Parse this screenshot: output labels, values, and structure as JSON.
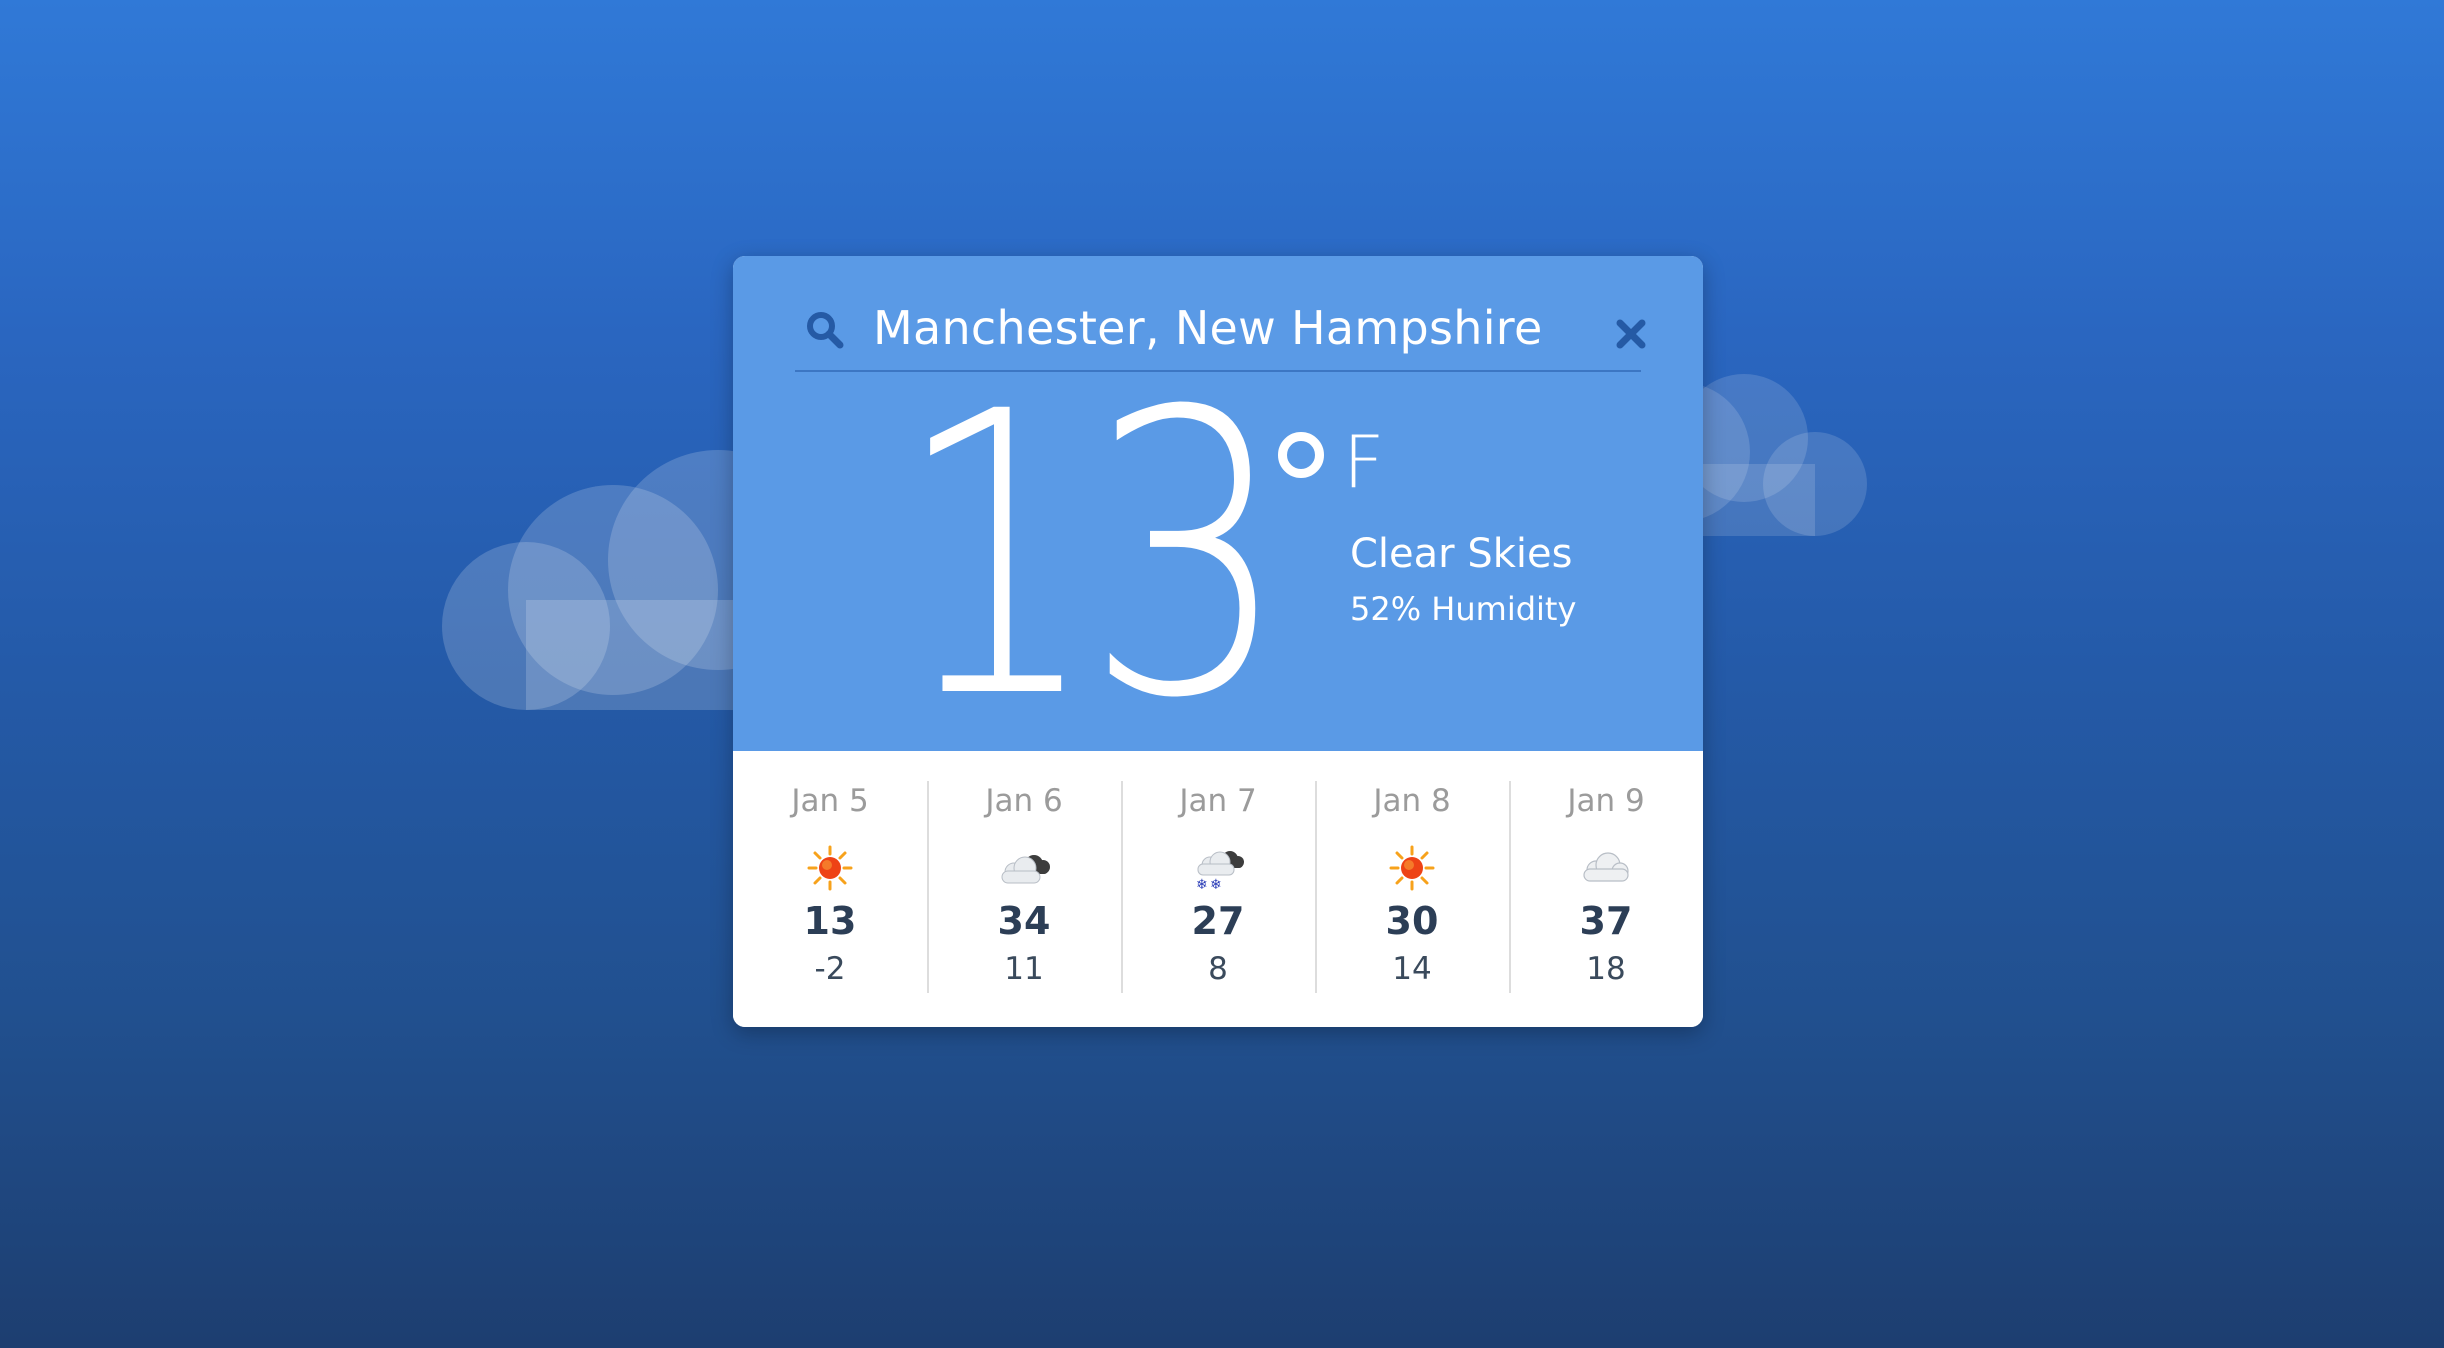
{
  "location": {
    "value": "Manchester, New Hampshire",
    "search_icon": "search-icon",
    "clear_icon": "close-icon"
  },
  "current": {
    "temperature": "13",
    "unit": "F",
    "conditions": "Clear Skies",
    "humidity": "52% Humidity"
  },
  "forecast": [
    {
      "date": "Jan 5",
      "icon": "sun-icon",
      "high": "13",
      "low": "-2"
    },
    {
      "date": "Jan 6",
      "icon": "partly-cloudy-icon",
      "high": "34",
      "low": "11"
    },
    {
      "date": "Jan 7",
      "icon": "snow-cloud-icon",
      "high": "27",
      "low": "8"
    },
    {
      "date": "Jan 8",
      "icon": "sun-icon",
      "high": "30",
      "low": "14"
    },
    {
      "date": "Jan 9",
      "icon": "cloud-icon",
      "high": "37",
      "low": "18"
    }
  ],
  "colors": {
    "background_top": "#3079d7",
    "background_bottom": "#1d3e70",
    "panel_blue": "#4e92e4",
    "accent_dark": "#255aa5",
    "high_temp_text": "#2c3e56"
  }
}
